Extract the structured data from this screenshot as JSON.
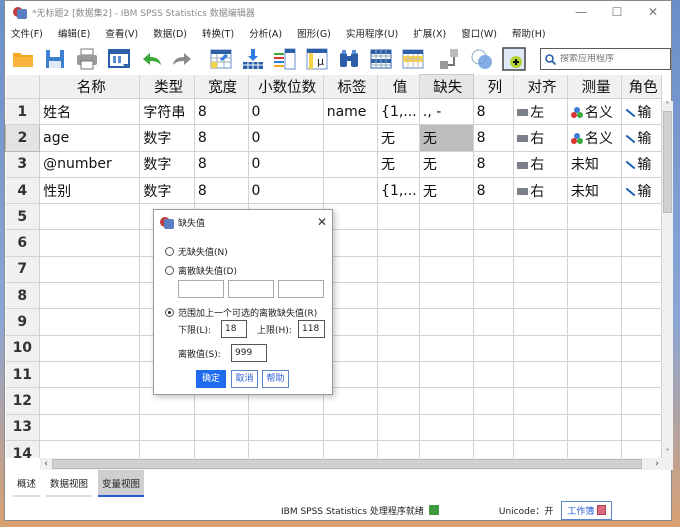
{
  "window": {
    "title": "*无标题2 [数据集2] - IBM SPSS Statistics 数据编辑器",
    "controls": {
      "minimize": "—",
      "maximize": "☐",
      "close": "✕"
    }
  },
  "menubar": [
    "文件(F)",
    "编辑(E)",
    "查看(V)",
    "数据(D)",
    "转换(T)",
    "分析(A)",
    "图形(G)",
    "实用程序(U)",
    "扩展(X)",
    "窗口(W)",
    "帮助(H)"
  ],
  "toolbar": {
    "icons": [
      "open-folder-icon",
      "save-icon",
      "print-icon",
      "dialog-recall-icon",
      "undo-icon",
      "redo-icon",
      "go-to-case-icon",
      "go-to-variable-icon",
      "variables-icon",
      "descriptive-stats-icon",
      "find-icon",
      "insert-cases-icon",
      "insert-variable-icon",
      "split-file-icon",
      "select-cases-icon",
      "value-labels-icon"
    ],
    "search_placeholder": "搜索应用程序"
  },
  "grid": {
    "columns": [
      "名称",
      "类型",
      "宽度",
      "小数位数",
      "标签",
      "值",
      "缺失",
      "列",
      "对齐",
      "测量",
      "角色"
    ],
    "rows": [
      {
        "num": "1",
        "name": "姓名",
        "type": "字符串",
        "width": "8",
        "decimals": "0",
        "label": "name",
        "values": "{1,...",
        "missing": "., -",
        "columns": "8",
        "align": "左",
        "measure": "名义",
        "measure_icon": true,
        "role": "输"
      },
      {
        "num": "2",
        "name": "age",
        "type": "数字",
        "width": "8",
        "decimals": "0",
        "label": "",
        "values": "无",
        "missing": "无",
        "columns": "8",
        "align": "右",
        "measure": "名义",
        "measure_icon": true,
        "role": "输"
      },
      {
        "num": "3",
        "name": "@number",
        "type": "数字",
        "width": "8",
        "decimals": "0",
        "label": "",
        "values": "无",
        "missing": "无",
        "columns": "8",
        "align": "右",
        "measure": "未知",
        "measure_icon": false,
        "role": "输"
      },
      {
        "num": "4",
        "name": "性别",
        "type": "数字",
        "width": "8",
        "decimals": "0",
        "label": "",
        "values": "{1,...",
        "missing": "无",
        "columns": "8",
        "align": "右",
        "measure": "未知",
        "measure_icon": false,
        "role": "输"
      }
    ],
    "empty_row_numbers": [
      "5",
      "6",
      "7",
      "8",
      "9",
      "10",
      "11",
      "12",
      "13",
      "14"
    ],
    "selected_cell": {
      "row": 2,
      "column": "缺失"
    }
  },
  "tabs": [
    {
      "label": "概述",
      "active": false
    },
    {
      "label": "数据视图",
      "active": false
    },
    {
      "label": "变量视图",
      "active": true
    }
  ],
  "statusbar": {
    "processor": "IBM SPSS Statistics 处理程序就绪",
    "unicode": "Unicode：开",
    "workbook": "工作簿"
  },
  "dialog": {
    "title": "缺失值",
    "option_none": "无缺失值(N)",
    "option_discrete": "离散缺失值(D)",
    "discrete_values": [
      "",
      "",
      ""
    ],
    "option_range": "范围加上一个可选的离散缺失值(R)",
    "selected_option": "range",
    "low_label": "下限(L):",
    "low_value": "18",
    "high_label": "上限(H):",
    "high_value": "118",
    "discrete_label": "离散值(S):",
    "discrete_value": "999",
    "buttons": {
      "ok": "确定",
      "cancel": "取消",
      "help": "帮助"
    }
  }
}
